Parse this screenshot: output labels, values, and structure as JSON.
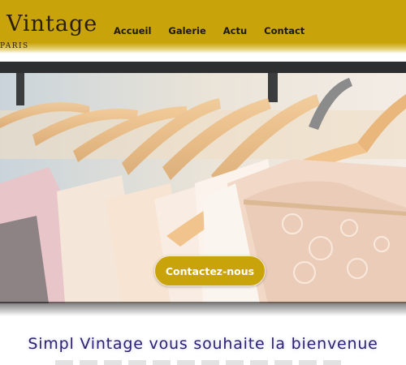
{
  "brand": {
    "name": "Vintage",
    "tagline": "PARIS"
  },
  "nav": {
    "items": [
      "Accueil",
      "Galerie",
      "Actu",
      "Contact"
    ]
  },
  "hero": {
    "cta_label": "Contactez-nous"
  },
  "welcome": {
    "title": "Simpl Vintage vous souhaite la bienvenue"
  },
  "colors": {
    "header": "#c9a30a",
    "accent_text": "#2b2275",
    "cta": "#c9a30a"
  }
}
